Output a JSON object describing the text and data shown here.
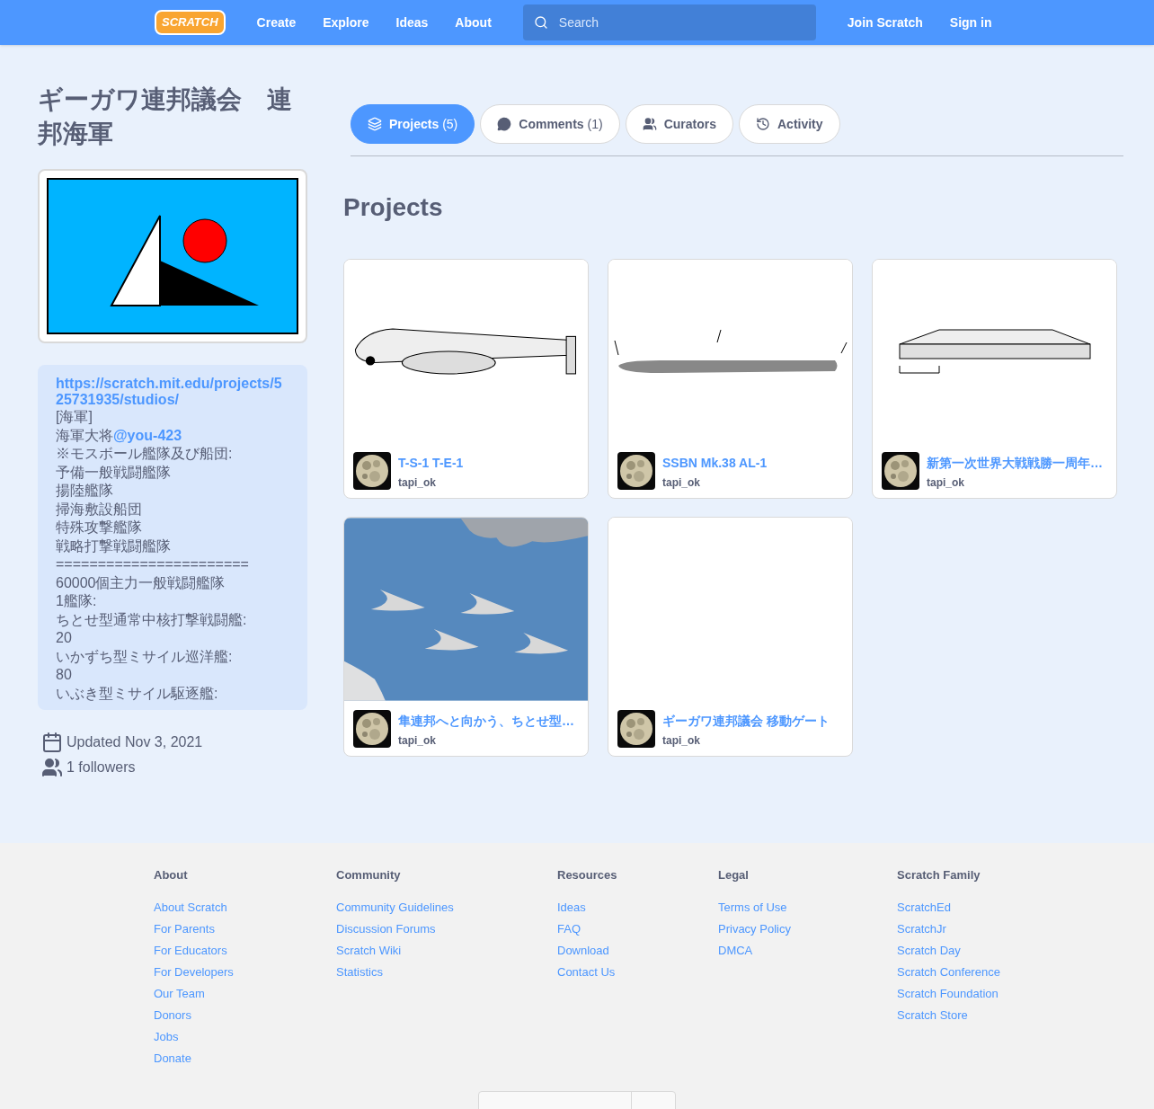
{
  "nav": {
    "logo": "SCRATCH",
    "links": [
      "Create",
      "Explore",
      "Ideas",
      "About"
    ],
    "search": {
      "placeholder": "Search"
    },
    "right": [
      "Join Scratch",
      "Sign in"
    ]
  },
  "studio": {
    "title": "ギーガワ連邦議会　連邦海軍",
    "description": [
      {
        "link": "https://scratch.mit.edu/projects/525731935/studios/"
      },
      {
        "text": "[海軍]"
      },
      {
        "text": "海軍大将",
        "link": "@you-423"
      },
      {
        "text": "※モスボール艦隊及び船団:"
      },
      {
        "text": "予備一般戦闘艦隊"
      },
      {
        "text": "揚陸艦隊"
      },
      {
        "text": "掃海敷設船団"
      },
      {
        "text": "特殊攻撃艦隊"
      },
      {
        "text": "戦略打撃戦闘艦隊"
      },
      {
        "text": "======================="
      },
      {
        "text": "60000個主力一般戦闘艦隊"
      },
      {
        "text": "1艦隊:"
      },
      {
        "text": "ちとせ型通常中核打撃戦闘艦:"
      },
      {
        "text": "20"
      },
      {
        "text": "いかずち型ミサイル巡洋艦:"
      },
      {
        "text": "80"
      },
      {
        "text": "いぶき型ミサイル駆逐艦:"
      }
    ],
    "updated": "Updated Nov 3, 2021",
    "followers": "1 followers"
  },
  "tabs": [
    {
      "label": "Projects",
      "count": "(5)",
      "selected": true
    },
    {
      "label": "Comments",
      "count": "(1)",
      "selected": false
    },
    {
      "label": "Curators",
      "selected": false
    },
    {
      "label": "Activity",
      "selected": false
    }
  ],
  "projects_heading": "Projects",
  "projects": [
    {
      "title": "T-S-1 T-E-1",
      "author": "tapi_ok"
    },
    {
      "title": "SSBN Mk.38 AL-1",
      "author": "tapi_ok"
    },
    {
      "title": "新第一次世界大戦戦勝一周年…",
      "author": "tapi_ok"
    },
    {
      "title": "隼連邦へと向かう、ちとせ型…",
      "author": "tapi_ok"
    },
    {
      "title": "ギーガワ連邦議会 移動ゲート",
      "author": "tapi_ok"
    }
  ],
  "footer": {
    "columns": [
      {
        "heading": "About",
        "links": [
          "About Scratch",
          "For Parents",
          "For Educators",
          "For Developers",
          "Our Team",
          "Donors",
          "Jobs",
          "Donate"
        ]
      },
      {
        "heading": "Community",
        "links": [
          "Community Guidelines",
          "Discussion Forums",
          "Scratch Wiki",
          "Statistics"
        ]
      },
      {
        "heading": "Resources",
        "links": [
          "Ideas",
          "FAQ",
          "Download",
          "Contact Us"
        ]
      },
      {
        "heading": "Legal",
        "links": [
          "Terms of Use",
          "Privacy Policy",
          "DMCA"
        ]
      },
      {
        "heading": "Scratch Family",
        "links": [
          "ScratchEd",
          "ScratchJr",
          "Scratch Day",
          "Scratch Conference",
          "Scratch Foundation",
          "Scratch Store"
        ]
      }
    ]
  }
}
